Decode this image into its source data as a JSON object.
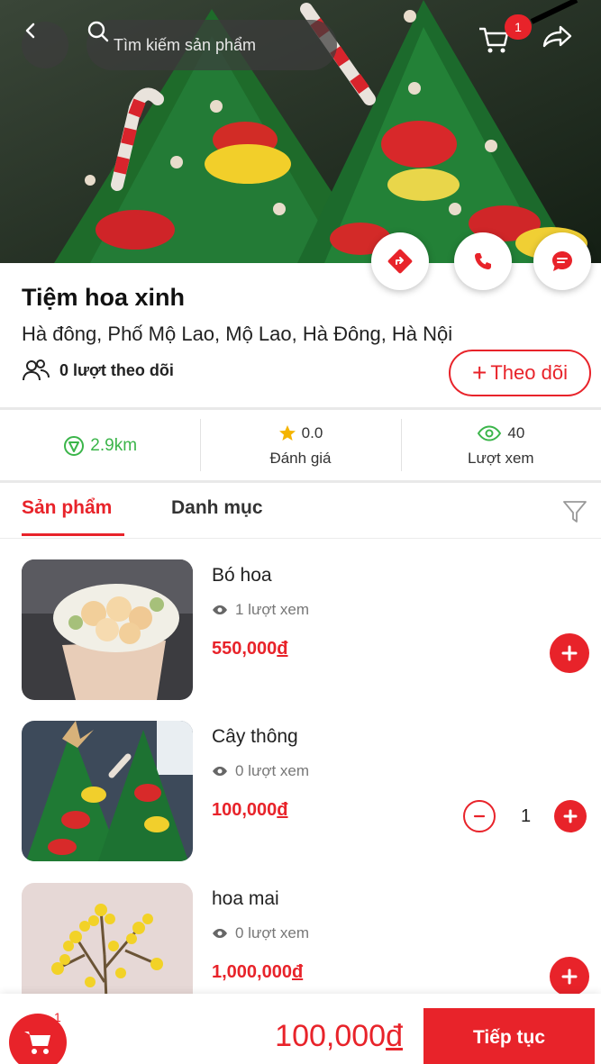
{
  "colors": {
    "accent": "#e8232a",
    "green": "#3bb54a"
  },
  "topbar": {
    "back_icon": "chevron-left-icon",
    "search_placeholder": "Tìm kiếm sản phẩm",
    "cart_badge": "1",
    "share_icon": "share-icon"
  },
  "actions": [
    "directions-icon",
    "phone-icon",
    "chat-icon"
  ],
  "shop": {
    "name": "Tiệm hoa xinh",
    "address": "Hà đông, Phố Mộ Lao, Mộ Lao, Hà Đông, Hà Nội",
    "followers": "0 lượt theo dõi",
    "follow_label": "Theo dõi"
  },
  "stats": {
    "distance": "2.9km",
    "rating": "0.0",
    "rating_label": "Đánh giá",
    "views": "40",
    "views_label": "Lượt xem"
  },
  "tabs": {
    "products": "Sản phẩm",
    "categories": "Danh mục"
  },
  "products": [
    {
      "name": "Bó hoa",
      "views": "1 lượt xem",
      "price": "550,000",
      "currency": "đ"
    },
    {
      "name": "Cây thông",
      "views": "0 lượt xem",
      "price": "100,000",
      "currency": "đ",
      "quantity": "1"
    },
    {
      "name": "hoa mai",
      "views": "0 lượt xem",
      "price": "1,000,000",
      "currency": "đ"
    }
  ],
  "bottom": {
    "cart_badge": "1",
    "total_amount": "100,000",
    "total_currency": "đ",
    "continue_label": "Tiếp tục"
  }
}
